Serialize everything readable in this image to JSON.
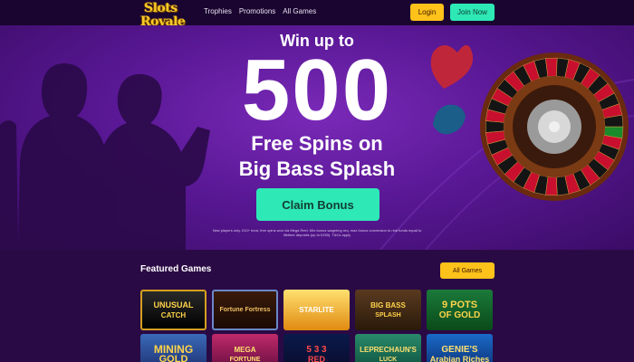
{
  "header": {
    "logo_line1": "Slots",
    "logo_line2": "Royale",
    "nav": [
      "Trophies",
      "Promotions",
      "All Games"
    ],
    "login_label": "Login",
    "join_label": "Join Now"
  },
  "hero": {
    "title_top": "Win up to",
    "number": "500",
    "line1": "Free Spins on",
    "line2": "Big Bass Splash",
    "cta_label": "Claim Bonus",
    "fineprint": "New players only. £10+ fund, free spins won via Mega Reel. 65x bonus wagering req. max bonus conversion to real funds equal to lifetime deposits (up to £250). T&Cs apply"
  },
  "featured": {
    "title": "Featured Games",
    "all_label": "All Games",
    "games": [
      {
        "line1": "UNUSUAL",
        "line2": "CATCH"
      },
      {
        "line1": "Fortune Fortress",
        "line2": ""
      },
      {
        "line1": "STARLITE",
        "line2": ""
      },
      {
        "line1": "BIG BASS",
        "line2": "SPLASH"
      },
      {
        "line1": "9 POTS",
        "line2": "OF GOLD"
      },
      {
        "line1": "MINING",
        "line2": "GOLD"
      },
      {
        "line1": "MEGA",
        "line2": "FORTUNE"
      },
      {
        "line1": "5 3 3",
        "line2": "RED"
      },
      {
        "line1": "LEPRECHAUN'S",
        "line2": "LUCK"
      },
      {
        "line1": "GENIE'S",
        "line2": "Arabian Riches"
      }
    ]
  },
  "colors": {
    "accent_yellow": "#ffc21a",
    "accent_teal": "#2ee8b6",
    "hero_purple": "#5a1896",
    "page_bg": "#2a0a44"
  }
}
